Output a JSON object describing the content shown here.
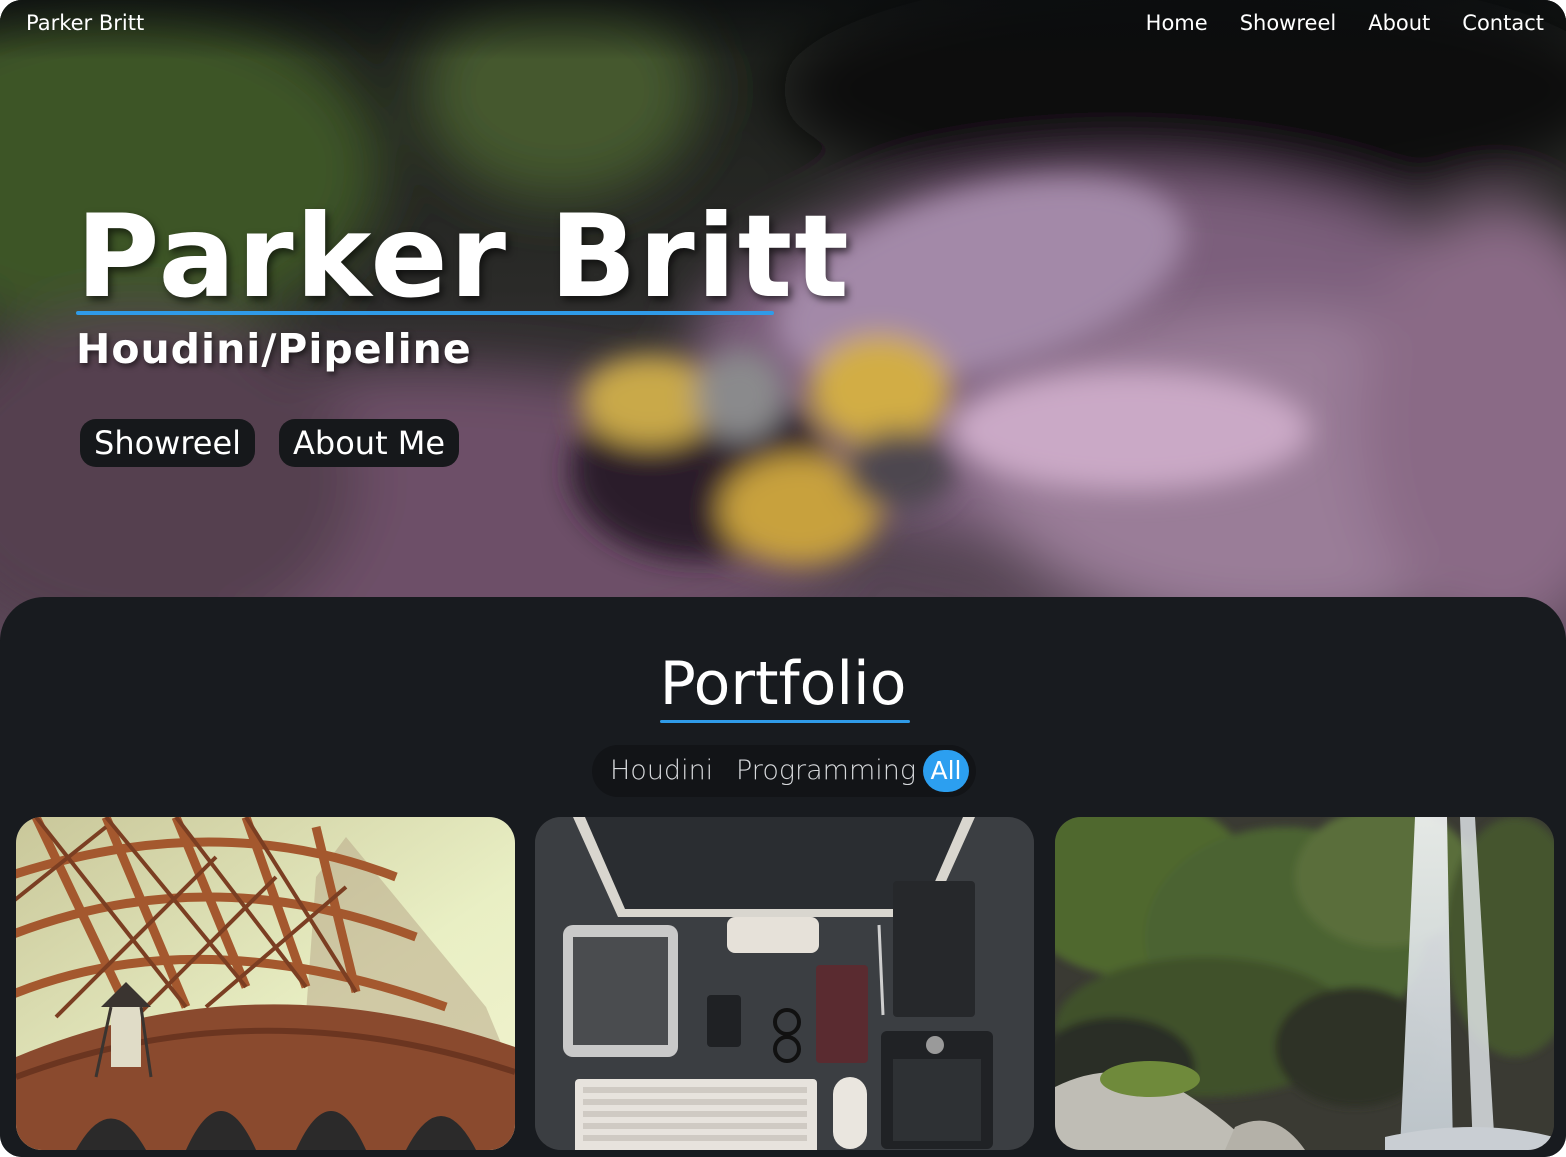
{
  "nav": {
    "brand": "Parker Britt",
    "links": [
      "Home",
      "Showreel",
      "About",
      "Contact"
    ]
  },
  "hero": {
    "title": "Parker Britt",
    "subtitle": "Houdini/Pipeline",
    "buttons": [
      "Showreel",
      "About Me"
    ]
  },
  "portfolio": {
    "title": "Portfolio",
    "filters": [
      "Houdini",
      "Programming",
      "All"
    ],
    "active_filter": "All",
    "cards": [
      {
        "subject": "steel bridge arches"
      },
      {
        "subject": "desk with devices"
      },
      {
        "subject": "waterfall and mossy cliff"
      }
    ]
  },
  "colors": {
    "accent": "#2f9be8",
    "panel": "#181b1f",
    "button_bg": "#16181b"
  }
}
